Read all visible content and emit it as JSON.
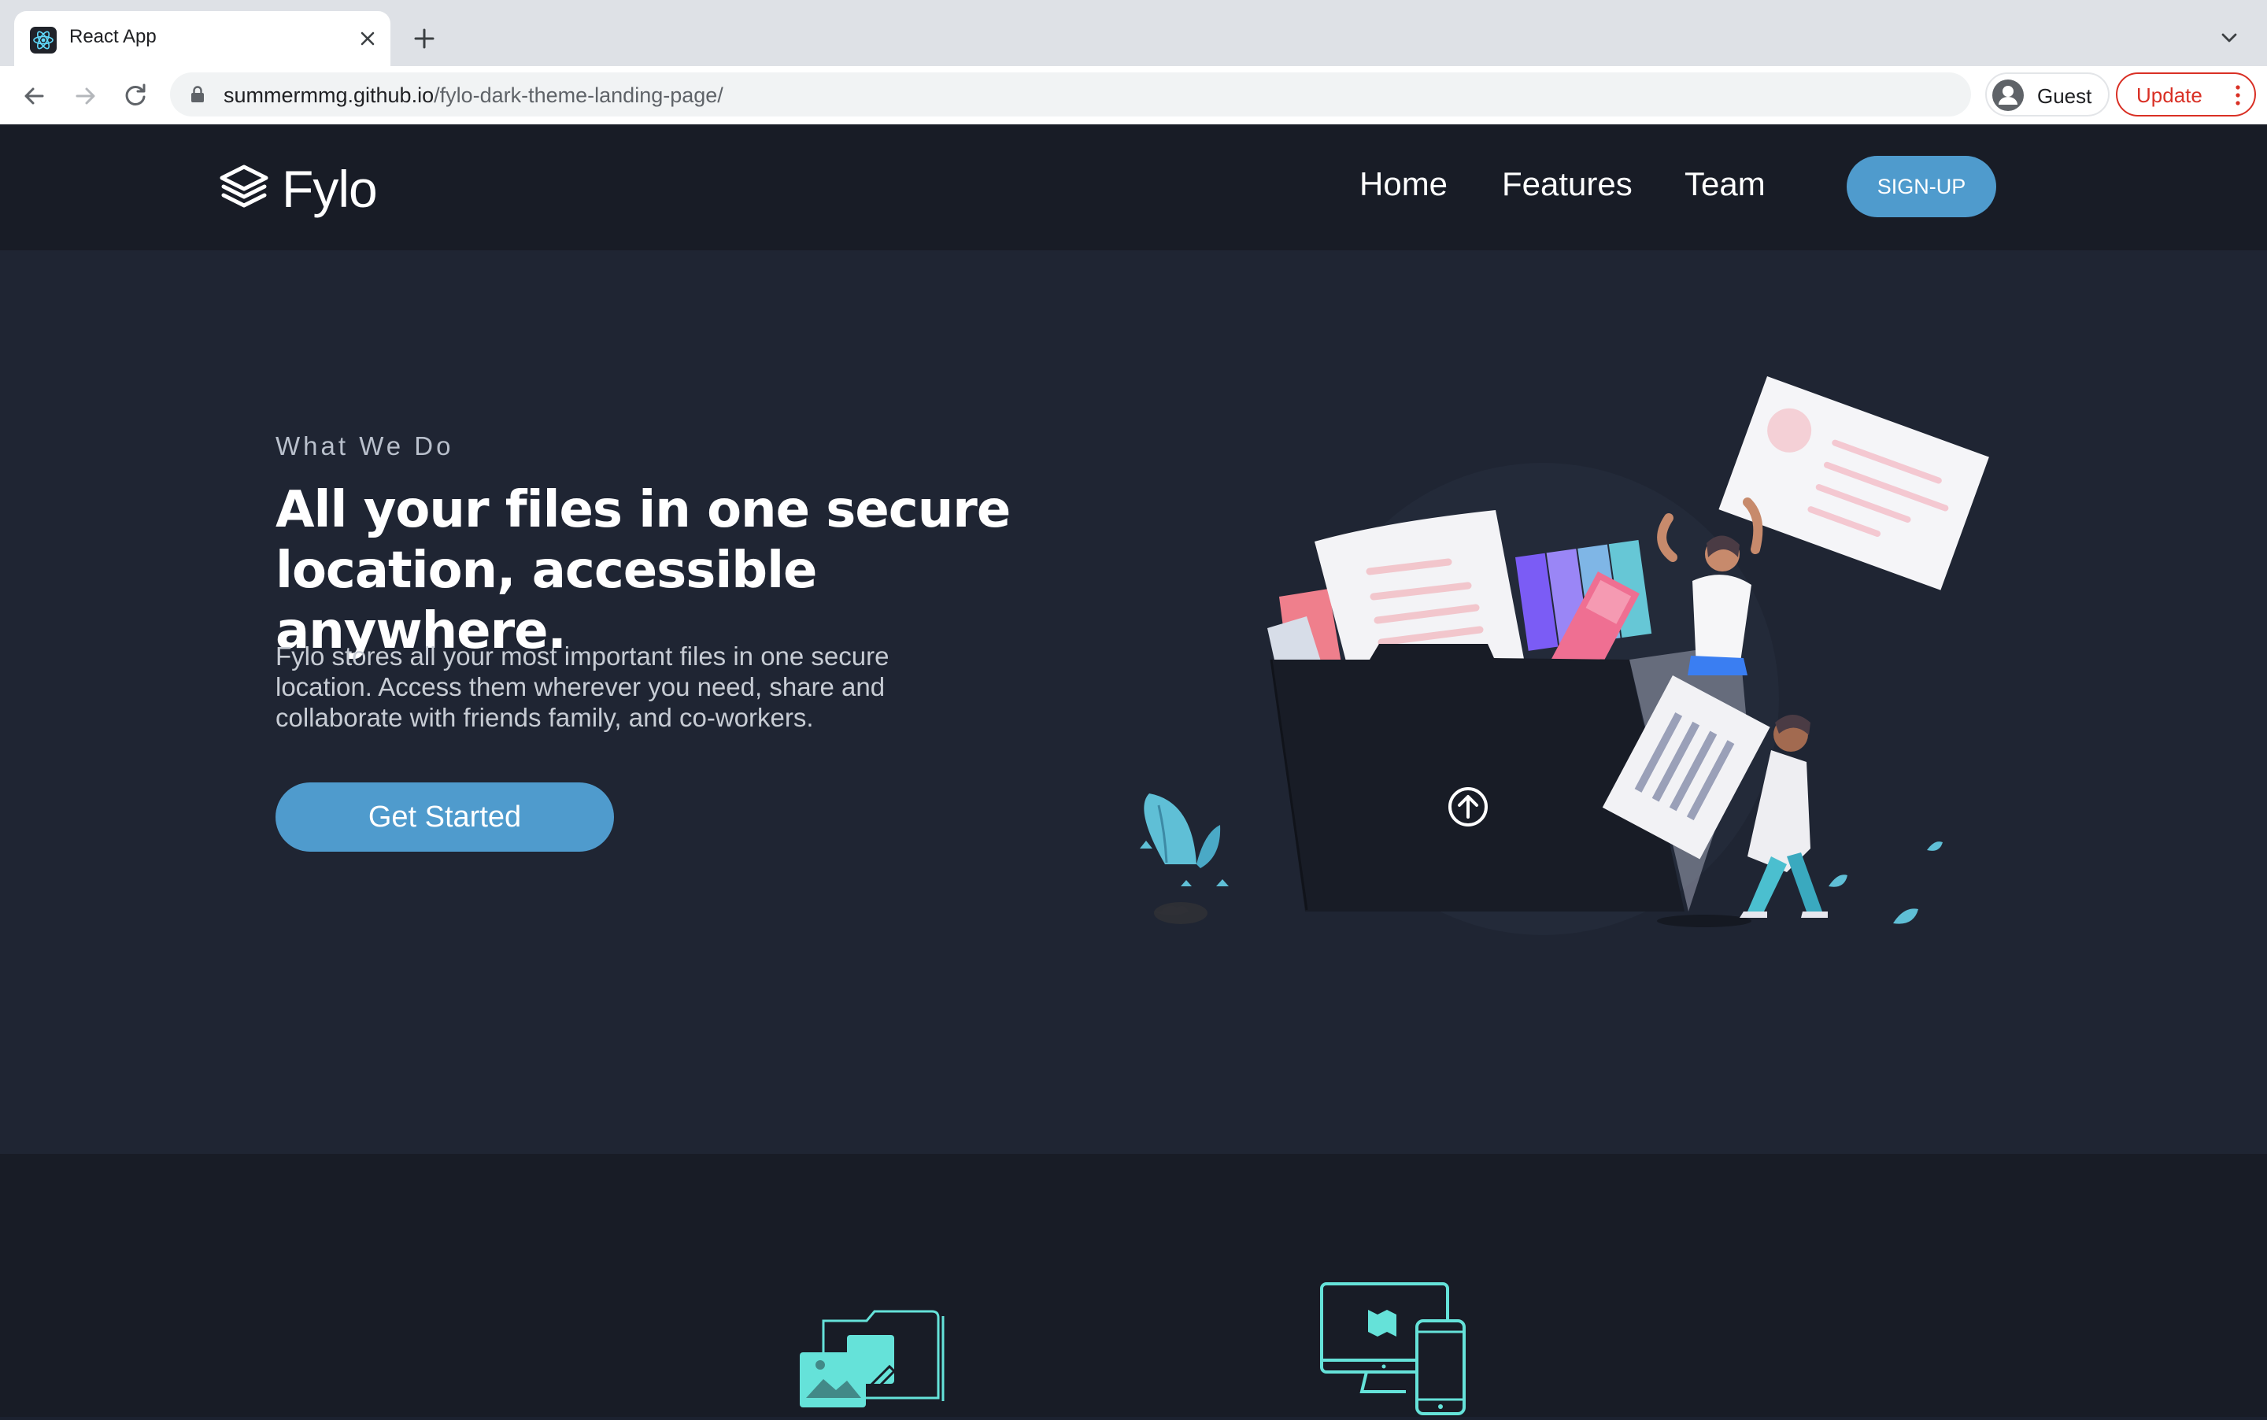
{
  "browser": {
    "tab_title": "React App",
    "url_host": "summermmg.github.io",
    "url_path": "/fylo-dark-theme-landing-page/",
    "profile_label": "Guest",
    "update_label": "Update"
  },
  "site": {
    "logo_text": "Fylo",
    "nav": [
      {
        "label": "Home"
      },
      {
        "label": "Features"
      },
      {
        "label": "Team"
      }
    ],
    "signup_label": "SIGN-UP"
  },
  "hero": {
    "eyebrow": "What We Do",
    "headline": "All your files in one secure location, accessible anywhere.",
    "lead": "Fylo stores all your most important files in one secure location. Access them wherever you need, share and collaborate with friends family, and co-workers.",
    "cta_label": "Get Started"
  },
  "colors": {
    "accent": "#4f9bcd",
    "header_bg": "#181c26",
    "hero_bg": "#1f2533",
    "feature_icon": "#65e2d9"
  },
  "features": {
    "icons": [
      "folder-images-icon",
      "devices-icon"
    ]
  }
}
